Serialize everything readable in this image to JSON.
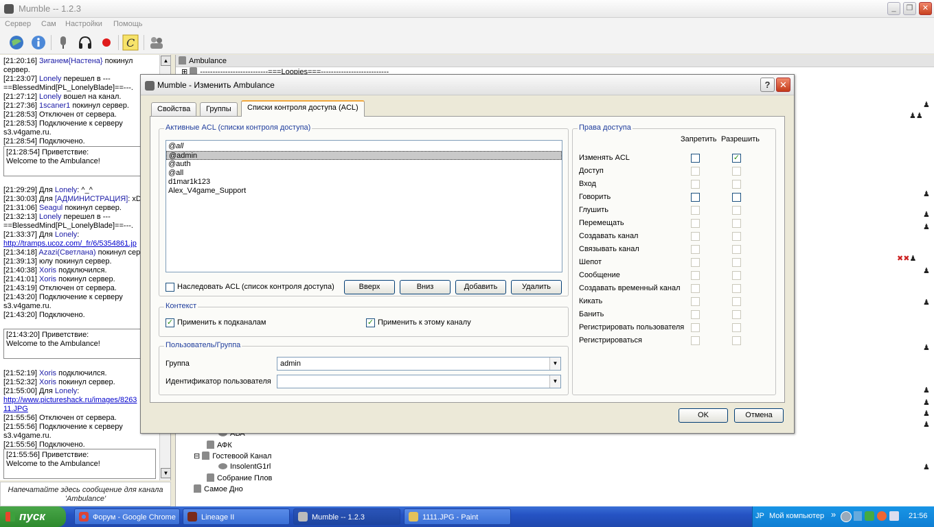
{
  "window": {
    "title": "Mumble -- 1.2.3"
  },
  "menu": [
    "Сервер",
    "Сам",
    "Настройки",
    "Помощь"
  ],
  "chat": {
    "lines1": [
      {
        "t": "[21:20:16] ",
        "u": "Зиганем{Настена}",
        "r": " покинул сервер."
      },
      {
        "t": "[21:23:07] ",
        "u": "Lonely",
        "r": " перешел в ---==BlessedMind[PL_LonelyBlade]==---."
      },
      {
        "t": "[21:27:12] ",
        "u": "Lonely",
        "r": " вошел на канал."
      },
      {
        "t": "[21:27:36] ",
        "u": "1scaner1",
        "r": " покинул сервер."
      },
      {
        "t": "[21:28:53] Отключен от сервера.",
        "u": "",
        "r": ""
      },
      {
        "t": "[21:28:53] Подключение к серверу s3.v4game.ru.",
        "u": "",
        "r": ""
      },
      {
        "t": "[21:28:54] Подключено.",
        "u": "",
        "r": ""
      }
    ],
    "greet1": [
      "[21:28:54] Приветствие:",
      "Welcome to the Ambulance!"
    ],
    "lines2": [
      {
        "t": "[21:29:29] Для ",
        "u": "Lonely",
        "r": ": ^_^"
      },
      {
        "t": "[21:30:03] Для ",
        "u": "[АДМИНИСТРАЦИЯ]",
        "r": ": xD"
      },
      {
        "t": "[21:31:06] ",
        "u": "Seagul",
        "r": " покинул сервер."
      },
      {
        "t": "[21:32:13] ",
        "u": "Lonely",
        "r": " перешел в ---==BlessedMind[PL_LonelyBlade]==---."
      },
      {
        "t": "[21:33:37] Для ",
        "u": "Lonely",
        "r": ":"
      },
      {
        "t": "",
        "link": "http://tramps.ucoz.com/_fr/6/5354861.jp",
        "u": "",
        "r": ""
      },
      {
        "t": "[21:34:18] ",
        "u": "Azazi(Светлана)",
        "r": " покинул сервер."
      },
      {
        "t": "[21:39:13] юлу покинул сервер.",
        "u": "",
        "r": ""
      },
      {
        "t": "[21:40:38] ",
        "u": "Xoris",
        "r": " подключился."
      },
      {
        "t": "[21:41:01] ",
        "u": "Xoris",
        "r": " покинул сервер."
      },
      {
        "t": "[21:43:19] Отключен от сервера.",
        "u": "",
        "r": ""
      },
      {
        "t": "[21:43:20] Подключение к серверу s3.v4game.ru.",
        "u": "",
        "r": ""
      },
      {
        "t": "[21:43:20] Подключено.",
        "u": "",
        "r": ""
      }
    ],
    "greet2": [
      "[21:43:20] Приветствие:",
      "Welcome to the Ambulance!"
    ],
    "lines3": [
      {
        "t": "[21:52:19] ",
        "u": "Xoris",
        "r": " подключился."
      },
      {
        "t": "[21:52:32] ",
        "u": "Xoris",
        "r": " покинул сервер."
      },
      {
        "t": "[21:55:00] Для ",
        "u": "Lonely",
        "r": ":"
      },
      {
        "t": "",
        "link": "http://www.pictureshack.ru/images/8263 11.JPG",
        "u": "",
        "r": ""
      },
      {
        "t": "[21:55:56] Отключен от сервера.",
        "u": "",
        "r": ""
      },
      {
        "t": "[21:55:56] Подключение к серверу s3.v4game.ru.",
        "u": "",
        "r": ""
      },
      {
        "t": "[21:55:56] Подключено.",
        "u": "",
        "r": ""
      }
    ],
    "greet3": [
      "[21:55:56] Приветствие:",
      "Welcome to the Ambulance!"
    ],
    "input_placeholder": "Напечатайте здесь сообщение для канала 'Ambulance'"
  },
  "tree": {
    "root": "Ambulance",
    "child1": "---------------------------===Loopies===---------------------------",
    "items": [
      "АВА",
      "АФК",
      "Гостевоой Канал",
      "InsolentG1rl",
      "Собрание Плов",
      "Самое Дно"
    ]
  },
  "dialog": {
    "title": "Mumble - Изменить Ambulance",
    "help": "?",
    "close": "✕",
    "tabs": [
      "Свойства",
      "Группы",
      "Списки контроля доступа (ACL)"
    ],
    "active_acl_label": "Активные ACL (списки контроля доступа)",
    "acl_list": [
      "@all",
      "@admin",
      "@auth",
      "@all",
      "d1mar1k123",
      "Alex_V4game_Support"
    ],
    "inherit_label": "Наследовать ACL (список контроля доступа)",
    "buttons": {
      "up": "Вверх",
      "down": "Вниз",
      "add": "Добавить",
      "remove": "Удалить"
    },
    "context_label": "Контекст",
    "apply_sub": "Применить к подканалам",
    "apply_this": "Применить к этому каналу",
    "usergroup_label": "Пользователь/Группа",
    "group_label": "Группа",
    "group_value": "admin",
    "userid_label": "Идентификатор пользователя",
    "userid_value": "",
    "rights_label": "Права доступа",
    "deny_header": "Запретить",
    "allow_header": "Разрешить",
    "rights": [
      "Изменять ACL",
      "Доступ",
      "Вход",
      "Говорить",
      "Глушить",
      "Перемещать",
      "Создавать канал",
      "Связывать канал",
      "Шепот",
      "Сообщение",
      "Создавать временный канал",
      "Кикать",
      "Банить",
      "Регистрировать пользователя",
      "Регистрироваться"
    ],
    "ok": "OK",
    "cancel": "Отмена"
  },
  "taskbar": {
    "start": "пуск",
    "tasks": [
      "Форум - Google Chrome",
      "Lineage II",
      "Mumble -- 1.2.3",
      "1111.JPG - Paint"
    ],
    "lang": "JP",
    "mycomp": "Мой компьютер",
    "clock": "21:56"
  }
}
